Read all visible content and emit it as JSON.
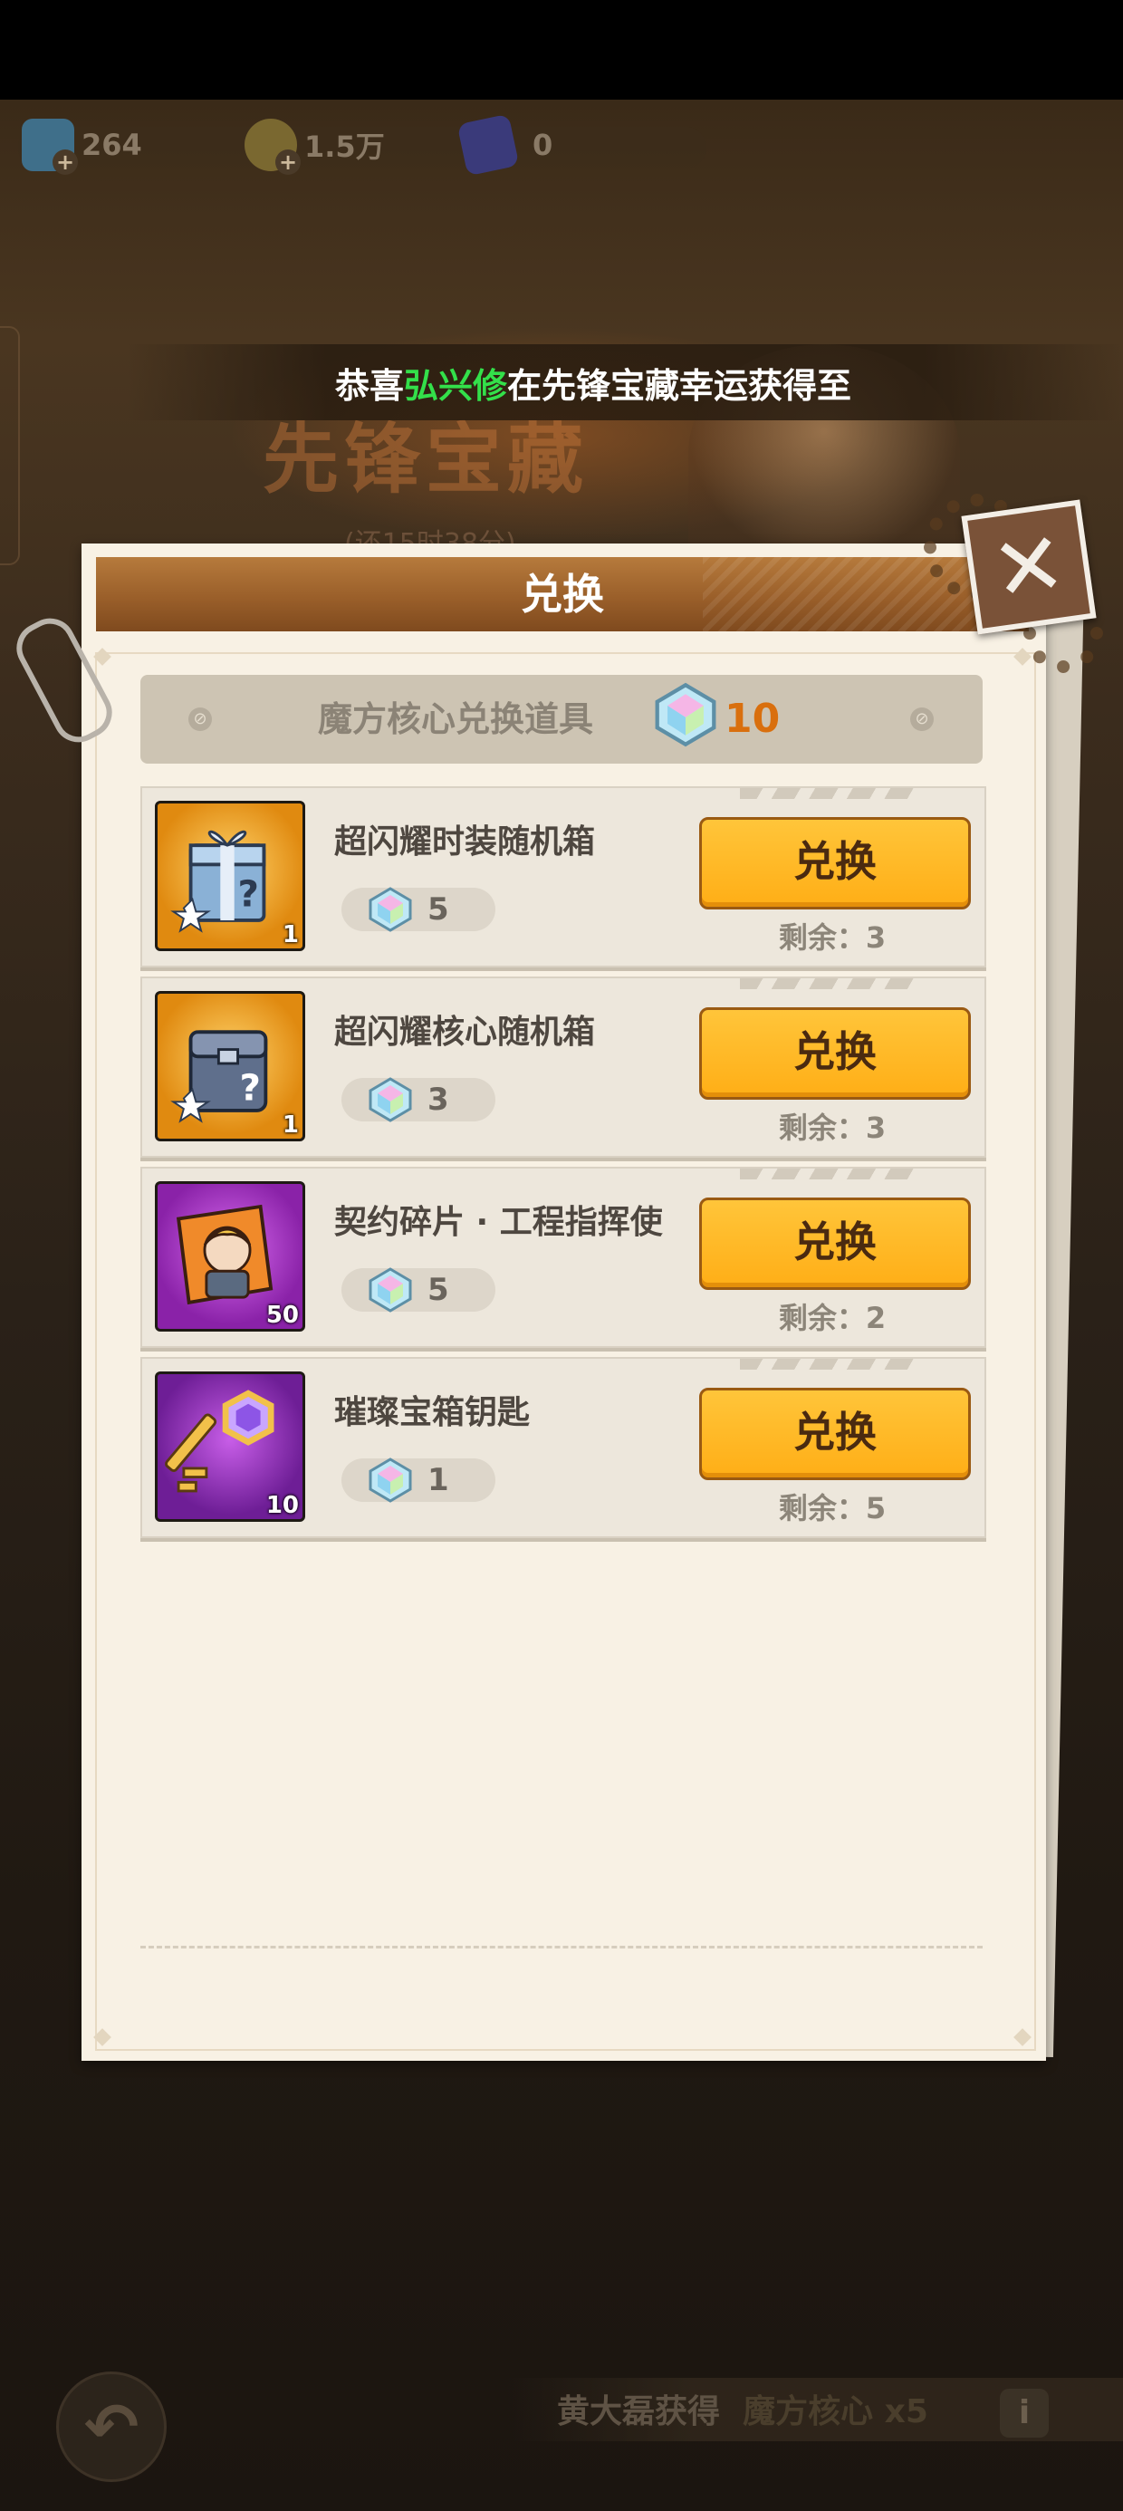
{
  "currencies": [
    {
      "icon": "diamond-currency-icon",
      "value": "264"
    },
    {
      "icon": "gold-coin-icon",
      "value": "1.5万"
    },
    {
      "icon": "card-ticket-icon",
      "value": "0"
    }
  ],
  "marquee": {
    "prefix": "恭喜",
    "player": "弘兴修",
    "suffix": "在先锋宝藏幸运获得至"
  },
  "background": {
    "logo": "先锋宝藏",
    "subtitle": "(还15时38分)"
  },
  "dialog": {
    "title": "兑换",
    "header_label": "魔方核心兑换道具",
    "header_amount": "10",
    "items": [
      {
        "name": "超闪耀时装随机箱",
        "qty": "1",
        "cost": "5",
        "button": "兑换",
        "remaining": "剩余：3",
        "thumb_color": "#f0a21c",
        "icon": "fashion-box-icon"
      },
      {
        "name": "超闪耀核心随机箱",
        "qty": "1",
        "cost": "3",
        "button": "兑换",
        "remaining": "剩余：3",
        "thumb_color": "#f0a21c",
        "icon": "core-box-icon"
      },
      {
        "name": "契约碎片 · 工程指挥使",
        "qty": "50",
        "cost": "5",
        "button": "兑换",
        "remaining": "剩余：2",
        "thumb_color": "#b43fd0",
        "icon": "contract-fragment-icon"
      },
      {
        "name": "璀璨宝箱钥匙",
        "qty": "10",
        "cost": "1",
        "button": "兑换",
        "remaining": "剩余：5",
        "thumb_color": "#9a34c4",
        "icon": "chest-key-icon"
      }
    ]
  },
  "bottom": {
    "player": "黄大磊获得",
    "item": "魔方核心 x5",
    "info": "i"
  }
}
